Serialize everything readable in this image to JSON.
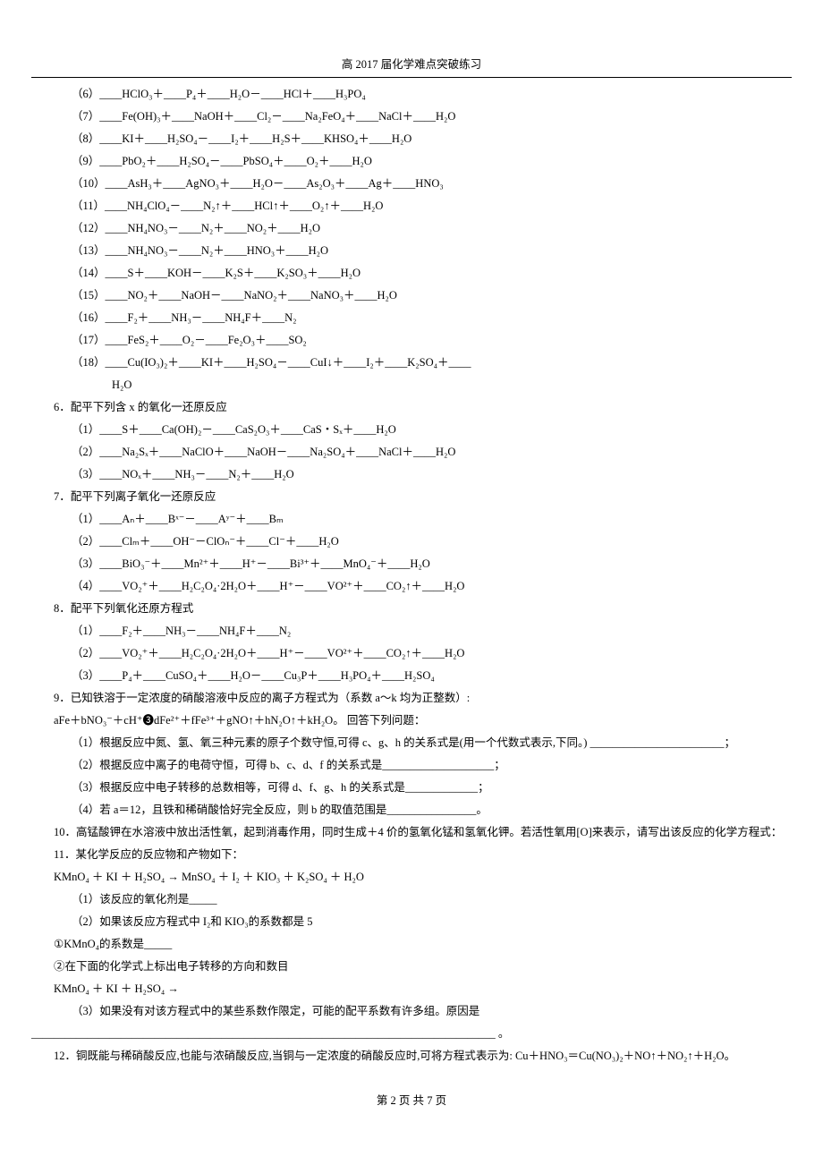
{
  "header": "高 2017 届化学难点突破练习",
  "eq5": {
    "6": "（6）____HClO₃＋____P₄＋____H₂O－____HCl＋____H₃PO₄",
    "7": "（7）____Fe(OH)₃＋____NaOH＋____Cl₂－____Na₂FeO₄＋____NaCl＋____H₂O",
    "8": "（8）____KI＋____H₂SO₄－____I₂＋____H₂S＋____KHSO₄＋____H₂O",
    "9": "（9）____PbO₂＋____H₂SO₄－____PbSO₄＋____O₂＋____H₂O",
    "10": "（10）____AsH₃＋____AgNO₃＋____H₂O－____As₂O₃＋____Ag＋____HNO₃",
    "11": "（11）____NH₄ClO₄－____N₂↑＋____HCl↑＋____O₂↑＋____H₂O",
    "12": "（12）____NH₄NO₃－____N₂＋____NO₂＋____H₂O",
    "13": "（13）____NH₄NO₃－____N₂＋____HNO₃＋____H₂O",
    "14": "（14）____S＋____KOH－____K₂S＋____K₂SO₃＋____H₂O",
    "15": "（15）____NO₂＋____NaOH－____NaNO₂＋____NaNO₃＋____H₂O",
    "16": "（16）____F₂＋____NH₃－____NH₄F＋____N₂",
    "17": "（17）____FeS₂＋____O₂－____Fe₂O₃＋____SO₂",
    "18": "（18）____Cu(IO₃)₂＋____KI＋____H₂SO₄－____CuI↓＋____I₂＋____K₂SO₄＋____",
    "18b": "H₂O"
  },
  "q6": {
    "title": "6．配平下列含 x 的氧化一还原反应",
    "1": "（1）____S＋____Ca(OH)₂－____CaS₂O₃＋____CaS・Sₓ＋____H₂O",
    "2": "（2）____Na₂Sₓ＋____NaClO＋____NaOH－____Na₂SO₄＋____NaCl＋____H₂O",
    "3": "（3）____NOₓ＋____NH₃－____N₂＋____H₂O"
  },
  "q7": {
    "title": "7．配平下列离子氧化一还原反应",
    "1": "（1）____Aₙ＋____Bˣ⁻－____Aʸ⁻＋____Bₘ",
    "2": "（2）____Clₘ＋____OH⁻－ClOₙ⁻＋____Cl⁻＋____H₂O",
    "3": "（3）____BiO₃⁻＋____Mn²⁺＋____H⁺－____Bi³⁺＋____MnO₄⁻＋____H₂O",
    "4": "（4）____VO₂⁺＋____H₂C₂O₄·2H₂O＋____H⁺－____VO²⁺＋____CO₂↑＋____H₂O"
  },
  "q8": {
    "title": "8．配平下列氧化还原方程式",
    "1": "（1）____F₂＋____NH₃－____NH₄F＋____N₂",
    "2": "（2）____VO₂⁺＋____H₂C₂O₄·2H₂O＋____H⁺－____VO²⁺＋____CO₂↑＋____H₂O",
    "3": "（3）____P₄＋____CuSO₄＋____H₂O－____Cu₃P＋____H₃PO₄＋____H₂SO₄"
  },
  "q9": {
    "title": "9．已知铁溶于一定浓度的硝酸溶液中反应的离子方程式为（系数 a～k 均为正整数）:",
    "eq": "aFe＋bNO₃⁻＋cH⁺❸dFe²⁺＋fFe³⁺＋gNO↑＋hN₂O↑＋kH₂O。 回答下列问题：",
    "p1": "（1）根据反应中氮、氢、氧三种元素的原子个数守恒,可得 c、g、h 的关系式是(用一个代数式表示,下同。) ________________________；",
    "p2": "（2）根据反应中离子的电荷守恒，可得 b、c、d、f 的关系式是____________________；",
    "p3": "（3）根据反应中电子转移的总数相等，可得 d、f、g、h 的关系式是_____________；",
    "p4": "（4）若 a＝12，且铁和稀硝酸恰好完全反应，则 b 的取值范围是________________。"
  },
  "q10": "10．高锰酸钾在水溶液中放出活性氧，起到消毒作用，同时生成＋4 价的氢氧化锰和氢氧化钾。若活性氧用[O]来表示，请写出该反应的化学方程式：",
  "q11": {
    "title": "11．某化学反应的反应物和产物如下：",
    "eq": "KMnO₄ ＋ KI ＋ H₂SO₄ → MnSO₄ ＋ I₂ ＋ KIO₃ ＋ K₂SO₄ ＋ H₂O",
    "p1": "（1）该反应的氧化剂是_____",
    "p2": "（2）如果该反应方程式中 I₂和 KIO₃的系数都是 5",
    "p2a": "①KMnO₄的系数是_____",
    "p2b": "②在下面的化学式上标出电子转移的方向和数目",
    "eq2": "KMnO₄ ＋ KI ＋ H₂SO₄ →",
    "p3": "（3）如果没有对该方程式中的某些系数作限定，可能的配平系数有许多组。原因是",
    "p3b": "___________________________________________________________________________________ 。"
  },
  "q12": "12．铜既能与稀硝酸反应,也能与浓硝酸反应,当铜与一定浓度的硝酸反应时,可将方程式表示为: Cu＋HNO₃＝Cu(NO₃)₂＋NO↑＋NO₂↑＋H₂O。",
  "footer": {
    "prefix": "第 ",
    "current": "2",
    "mid": " 页 共 ",
    "total": "7",
    "suffix": " 页"
  }
}
